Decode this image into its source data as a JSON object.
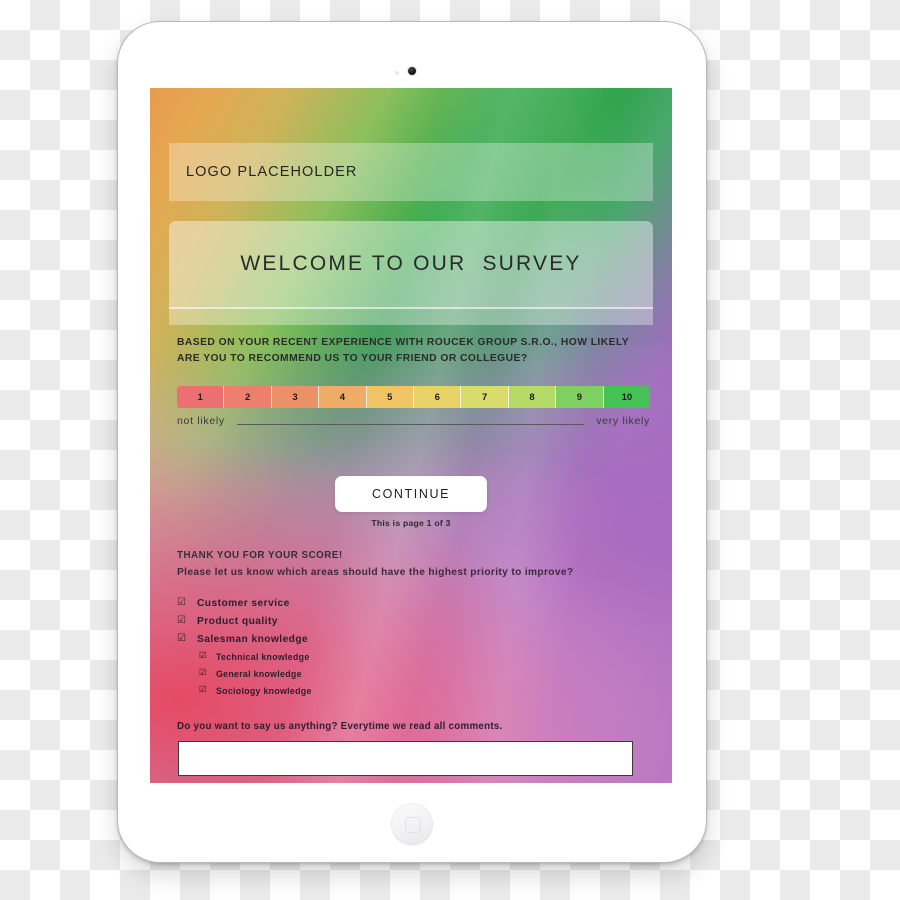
{
  "device": {
    "type": "tablet",
    "camera_icon": "camera-dot",
    "sensor_icon": "ambient-light-sensor",
    "home_button_icon": "home-button"
  },
  "screen": {
    "logo_bar": {
      "text": "LOGO PLACEHOLDER"
    },
    "welcome": {
      "title": "WELCOME TO OUR  SURVEY"
    },
    "question": {
      "line1": "BASED ON YOUR RECENT EXPERIENCE WITH ROUCEK GROUP S.R.O., HOW LIKELY",
      "line2": "ARE YOU TO RECOMMEND US TO YOUR FRIEND OR COLLEGUE?"
    },
    "scale": {
      "values": [
        "1",
        "2",
        "3",
        "4",
        "5",
        "6",
        "7",
        "8",
        "9",
        "10"
      ],
      "colors": [
        "#ec6f71",
        "#ed7f6e",
        "#eb9168",
        "#eeac66",
        "#f0c465",
        "#e8d268",
        "#d9dc6c",
        "#b6da68",
        "#7fd063",
        "#45c256"
      ],
      "left_label": "not likely",
      "right_label": "very likely"
    },
    "continue": {
      "label": "CONTINUE",
      "page_indicator": "This is page 1 of 3"
    },
    "thanks": {
      "heading": "THANK YOU FOR YOUR SCORE!",
      "subheading": "Please let us know which areas should have the highest priority to improve?"
    },
    "checklist": [
      {
        "label": "Customer service",
        "checkbox": "☑",
        "level": 0
      },
      {
        "label": "Product quality",
        "checkbox": "☑",
        "level": 0
      },
      {
        "label": "Salesman knowledge",
        "checkbox": "☑",
        "level": 0
      },
      {
        "label": "Technical knowledge",
        "checkbox": "☑",
        "level": 1
      },
      {
        "label": "General knowledge",
        "checkbox": "☑",
        "level": 1
      },
      {
        "label": "Sociology knowledge",
        "checkbox": "☑",
        "level": 1
      }
    ],
    "comment": {
      "label": "Do you want to say us anything? Everytime we read all comments.",
      "value": "",
      "placeholder": ""
    }
  }
}
